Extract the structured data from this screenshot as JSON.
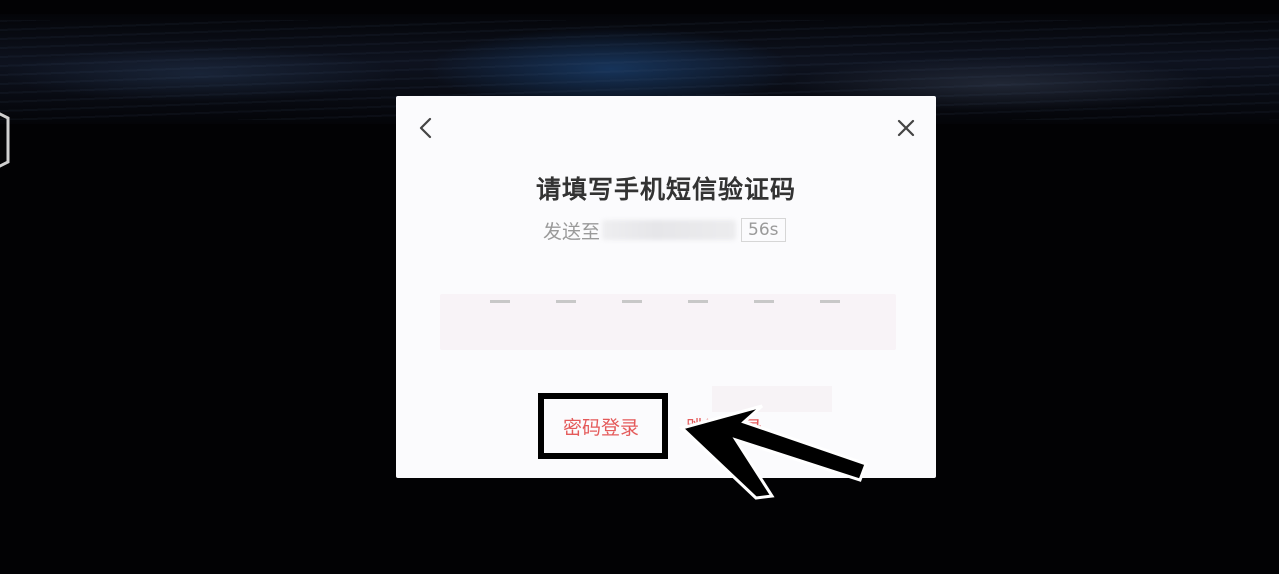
{
  "dialog": {
    "title": "请填写手机短信验证码",
    "sent_label": "发送至",
    "countdown": "56s",
    "code_length": 6,
    "password_login_label": "密码登录",
    "skip_label": "跳过登录"
  },
  "icons": {
    "back": "chevron-left-icon",
    "close": "close-icon",
    "annotation": "arrow-icon"
  },
  "colors": {
    "accent": "#e45a5a",
    "modal_bg": "#fbfbfd",
    "code_box_bg": "#f8f3f7"
  }
}
